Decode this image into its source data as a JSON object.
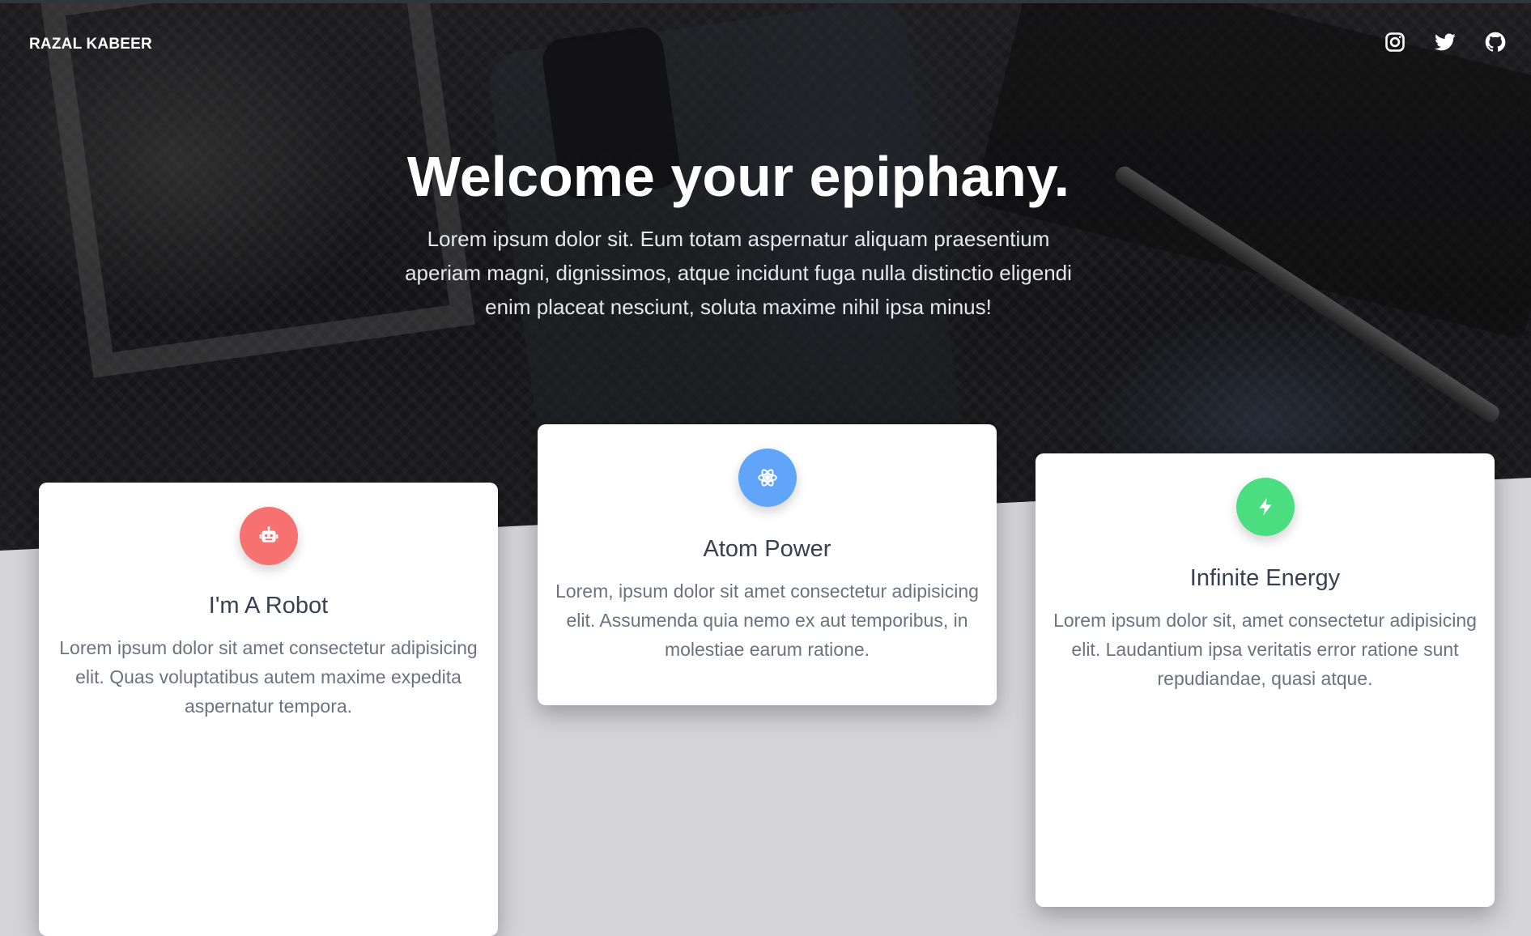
{
  "brand": {
    "name": "RAZAL KABEER"
  },
  "social": [
    {
      "icon": "instagram-icon"
    },
    {
      "icon": "twitter-icon"
    },
    {
      "icon": "github-icon"
    }
  ],
  "hero": {
    "title": "Welcome your epiphany.",
    "subtitle": "Lorem ipsum dolor sit. Eum totam aspernatur aliquam praesentium aperiam magni, dignissimos, atque incidunt fuga nulla distinctio eligendi enim placeat nesciunt, soluta maxime nihil ipsa minus!"
  },
  "cards": [
    {
      "icon": "robot-icon",
      "icon_color": "#f87171",
      "title": "I'm A Robot",
      "text": "Lorem ipsum dolor sit amet consectetur adipisicing elit. Quas voluptatibus autem maxime expedita aspernatur tempora."
    },
    {
      "icon": "atom-icon",
      "icon_color": "#60a5fa",
      "title": "Atom Power",
      "text": "Lorem, ipsum dolor sit amet consectetur adipisicing elit. Assumenda quia nemo ex aut temporibus, in molestiae earum ratione."
    },
    {
      "icon": "bolt-icon",
      "icon_color": "#4ade80",
      "title": "Infinite Energy",
      "text": "Lorem ipsum dolor sit, amet consectetur adipisicing elit. Laudantium ipsa veritatis error ratione sunt repudiandae, quasi atque."
    }
  ],
  "colors": {
    "page_background": "#d4d4d8",
    "card_background": "#ffffff",
    "title_text": "#374151",
    "body_text": "#6b7280"
  }
}
